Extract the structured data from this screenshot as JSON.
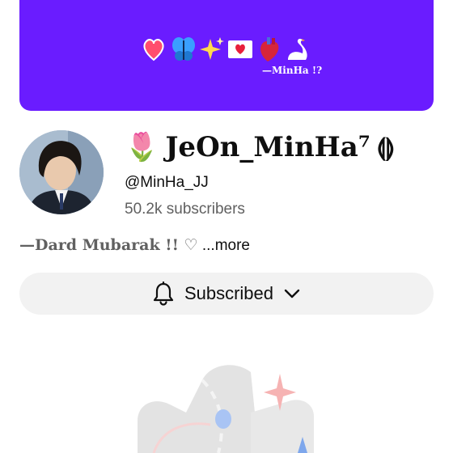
{
  "banner": {
    "signature": "—MinHa !?",
    "emojis": [
      "heart-icon",
      "butterfly-icon",
      "sparkles-icon",
      "love-letter-icon",
      "anatomical-heart-icon",
      "swan-icon"
    ],
    "background": "#6a1cff"
  },
  "channel": {
    "emoji": "🌷",
    "name": "JeOn_MinHa⁷",
    "name_tail": "⟬⟭",
    "handle": "@MinHa_JJ",
    "subscribers": "50.2k subscribers"
  },
  "description": {
    "text": "—Dard Mubarak !! ♡",
    "more": "...more"
  },
  "subscribe_button": {
    "label": "Subscribed",
    "icon": "bell-icon",
    "chevron": "chevron-down-icon",
    "background": "#f2f2f2"
  },
  "watermark": {
    "icon": "illustration-icon"
  }
}
